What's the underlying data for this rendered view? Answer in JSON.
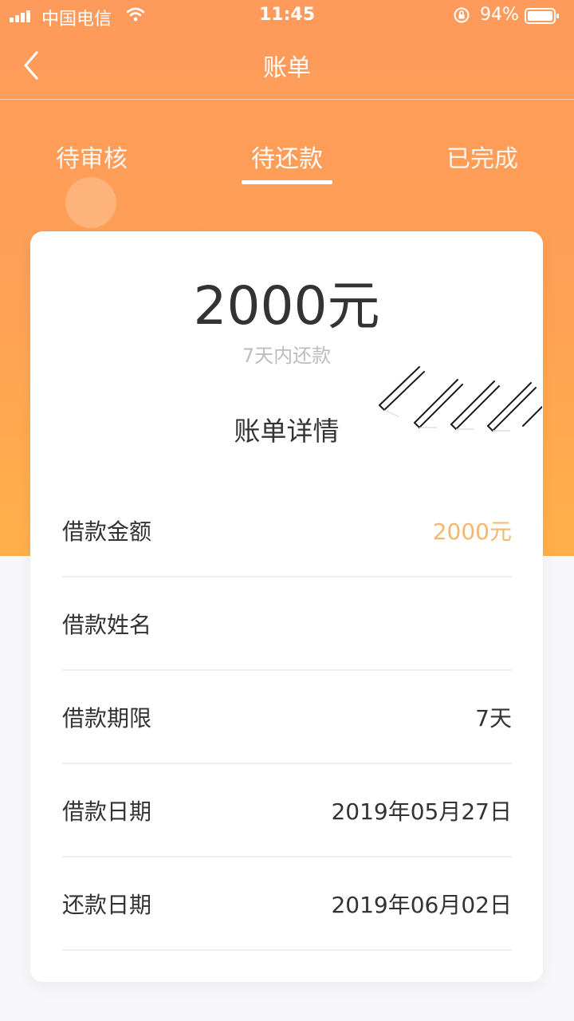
{
  "status_bar": {
    "carrier": "中国电信",
    "time": "11:45",
    "battery": "94%",
    "icons": [
      "signal-icon",
      "wifi-icon",
      "rotation-lock-icon",
      "battery-icon"
    ]
  },
  "nav": {
    "title": "账单",
    "back_icon": "chevron-left-icon"
  },
  "tabs": [
    {
      "label": "待审核",
      "active": false
    },
    {
      "label": "待还款",
      "active": true
    },
    {
      "label": "已完成",
      "active": false
    }
  ],
  "bill": {
    "amount": "2000元",
    "subtitle": "7天内还款",
    "detail_title": "账单详情",
    "rows": [
      {
        "label": "借款金额",
        "value": "2000元"
      },
      {
        "label": "借款姓名",
        "value": ""
      },
      {
        "label": "借款期限",
        "value": "7天"
      },
      {
        "label": "借款日期",
        "value": "2019年05月27日"
      },
      {
        "label": "还款日期",
        "value": "2019年06月02日"
      }
    ]
  },
  "colors": {
    "header_top": "#fe9a5b",
    "header_bottom": "#ffb04a",
    "accent_value": "#f5b76a",
    "page_background": "#f7f7fa"
  }
}
